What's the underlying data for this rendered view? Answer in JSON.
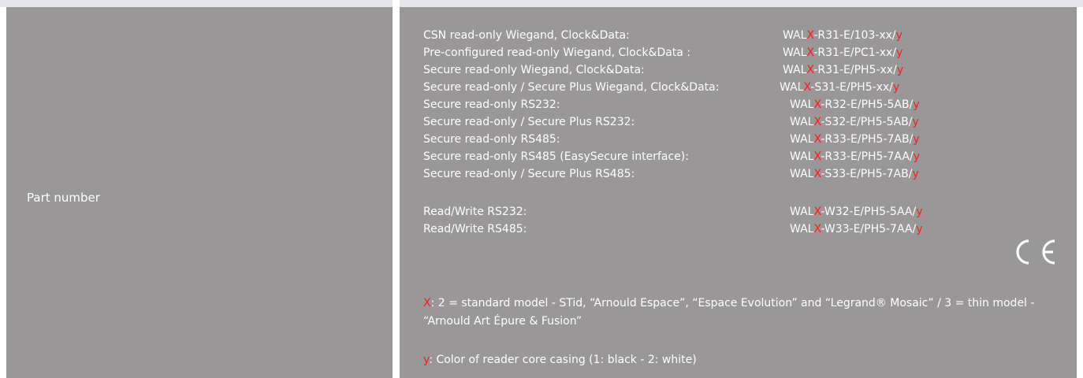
{
  "left_cell": {
    "label": "Part number"
  },
  "rows": [
    {
      "desc": "CSN read-only Wiegand, Clock&Data:",
      "pn": [
        "WAL",
        "X",
        "-R31-E/103-xx/",
        "y"
      ]
    },
    {
      "desc": "Pre-configured read-only Wiegand, Clock&Data :",
      "pn": [
        "WAL",
        "X",
        "-R31-E/PC1-xx/",
        "y"
      ]
    },
    {
      "desc": "Secure read-only Wiegand, Clock&Data:",
      "pn": [
        "WAL",
        "X",
        "-R31-E/PH5-xx/",
        "y"
      ]
    },
    {
      "desc": "Secure read-only / Secure Plus Wiegand, Clock&Data:",
      "pn": [
        "WAL",
        "X",
        "-S31-E/PH5-xx/",
        "y"
      ]
    },
    {
      "desc": "Secure read-only RS232:",
      "pn": [
        "WAL",
        "X",
        "-R32-E/PH5-5AB/",
        "y"
      ]
    },
    {
      "desc": "Secure read-only / Secure Plus RS232:",
      "pn": [
        "WAL",
        "X",
        "-S32-E/PH5-5AB/",
        "y"
      ]
    },
    {
      "desc": "Secure read-only RS485:",
      "pn": [
        "WAL",
        "X",
        "-R33-E/PH5-7AB/",
        "y"
      ]
    },
    {
      "desc": "Secure read-only RS485 (EasySecure interface):",
      "pn": [
        "WAL",
        "X",
        "-R33-E/PH5-7AA/",
        "y"
      ]
    },
    {
      "desc": "Secure read-only / Secure Plus RS485:",
      "pn": [
        "WAL",
        "X",
        "-S33-E/PH5-7AB/",
        "y"
      ]
    },
    {
      "desc": "Read/Write RS232:",
      "pn": [
        "WAL",
        "X",
        "-W32-E/PH5-5AA/",
        "y"
      ]
    },
    {
      "desc": "Read/Write RS485:",
      "pn": [
        "WAL",
        "X",
        "-W33-E/PH5-7AA/",
        "y"
      ]
    }
  ],
  "notes": {
    "x_key": "X",
    "x_text": ": 2 = standard model - STid, “Arnould Espace”, “Espace Evolution” and “Legrand® Mosaic” / 3 = thin model - “Arnould Art Épure & Fusion”",
    "y_key": "y",
    "y_text": ": Color of reader core casing (1: black - 2: white)"
  },
  "colors": {
    "cell_bg": "#999797",
    "text": "#ffffff",
    "highlight": "#ff1a1a",
    "strip": "#e6e7ec"
  },
  "icons": {
    "ce_mark": "ce-mark-icon"
  }
}
